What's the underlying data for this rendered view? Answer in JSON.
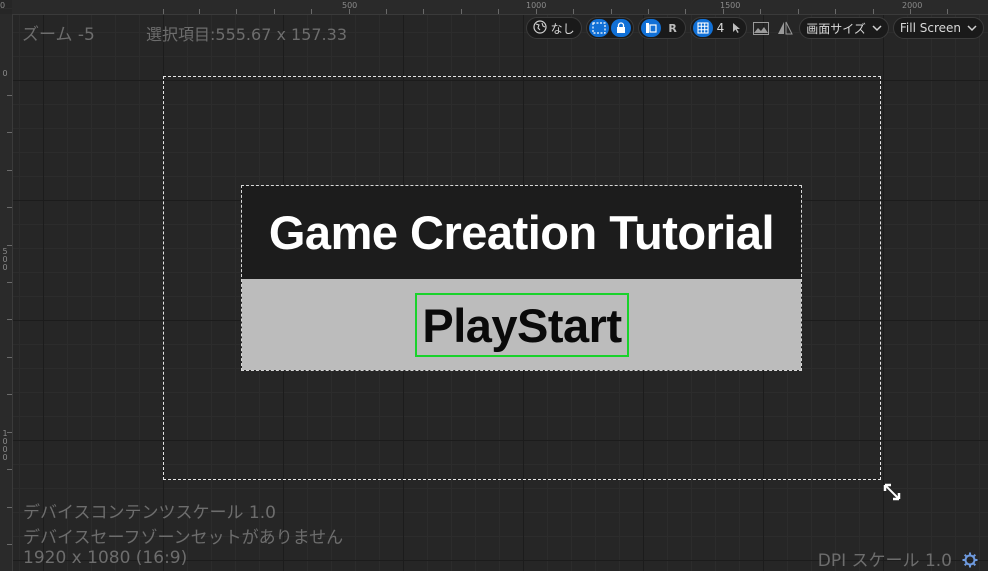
{
  "viewport": {
    "zoom_label": "ズーム -5",
    "selection_label": "選択項目:555.67 x 157.33",
    "device_content_scale": "デバイスコンテンツスケール 1.0",
    "safe_zone_status": "デバイスセーフゾーンセットがありません",
    "resolution": "1920 x 1080 (16:9)",
    "dpi_scale": "DPI スケール 1.0"
  },
  "ruler": {
    "top_labels": [
      "0",
      "500",
      "1000",
      "1500",
      "2000"
    ],
    "left_labels": [
      "0",
      "500",
      "1000"
    ]
  },
  "toolbar": {
    "world_label": "なし",
    "r_label": "R",
    "grid_value": "4",
    "screen_size_label": "画面サイズ",
    "fill_screen_label": "Fill Screen"
  },
  "widget": {
    "title": "Game Creation Tutorial",
    "button_label": "PlayStart"
  },
  "colors": {
    "accent": "#1170d6",
    "selection_outline": "#19d22b",
    "title_bg": "#1c1c1c",
    "button_bg": "#bcbcbc"
  }
}
